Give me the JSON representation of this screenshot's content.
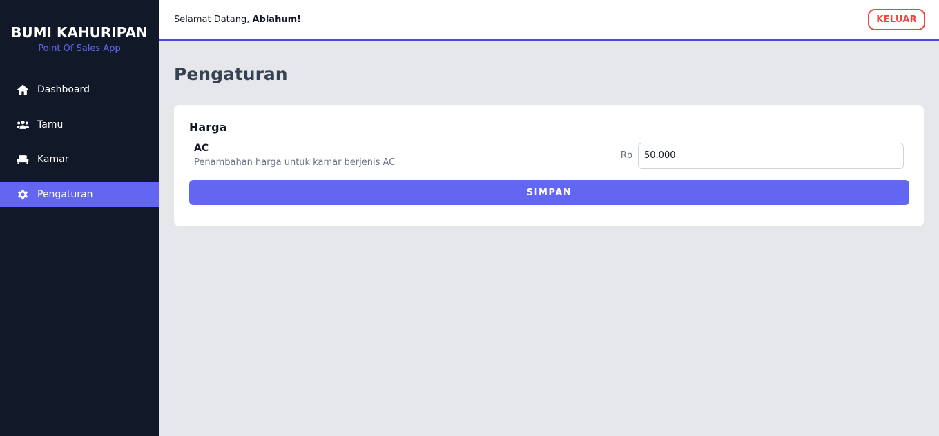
{
  "brand": {
    "title": "BUMI KAHURIPAN",
    "subtitle": "Point Of Sales App"
  },
  "sidebar": {
    "items": [
      {
        "label": "Dashboard",
        "icon": "home-icon",
        "active": false
      },
      {
        "label": "Tamu",
        "icon": "users-icon",
        "active": false
      },
      {
        "label": "Kamar",
        "icon": "bed-icon",
        "active": false
      },
      {
        "label": "Pengaturan",
        "icon": "gear-icon",
        "active": true
      }
    ]
  },
  "header": {
    "welcome_prefix": "Selamat Datang, ",
    "user_name": "Ablahum!",
    "logout_label": "KELUAR"
  },
  "main": {
    "page_title": "Pengaturan",
    "card": {
      "title": "Harga",
      "setting": {
        "name": "AC",
        "description": "Penambahan harga untuk kamar berjenis AC",
        "currency": "Rp",
        "value": "50.000"
      },
      "save_label": "SIMPAN"
    }
  },
  "colors": {
    "sidebar_bg": "#111827",
    "accent": "#6366f1",
    "danger": "#ef4444",
    "page_bg": "#e5e7eb"
  }
}
